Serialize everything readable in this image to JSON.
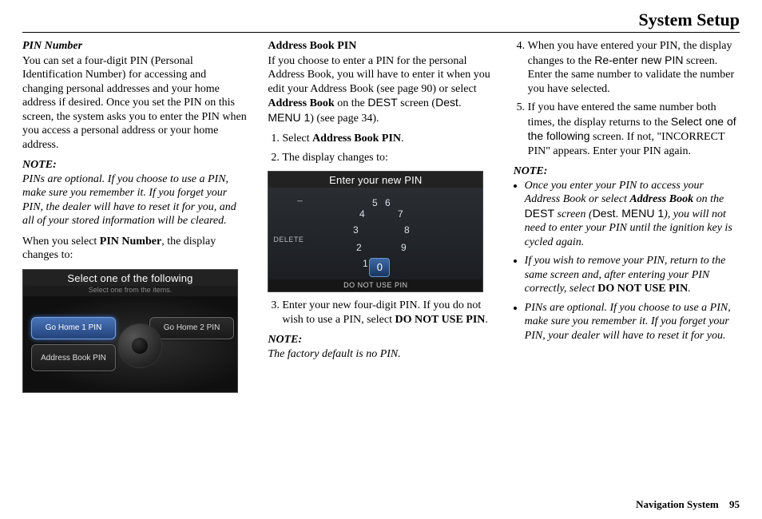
{
  "header": "System Setup",
  "footer": {
    "label": "Navigation System",
    "page": "95"
  },
  "col1": {
    "title": "PIN Number",
    "p1": "You can set a four-digit PIN (Personal Identification Number) for accessing and changing personal addresses and your home address if desired. Once you set the PIN on this screen, the system asks you to enter the PIN when you access a personal address or your home address.",
    "note_label": "NOTE:",
    "note1": "PINs are optional. If you choose to use a PIN, make sure you remember it. If you forget your PIN, the dealer will have to reset it for you, and all of your stored information will be cleared.",
    "p2_a": "When you select ",
    "p2_b": "PIN Number",
    "p2_c": ", the display changes to:",
    "shot": {
      "title": "Select one of the following",
      "subtitle": "Select one from the items.",
      "btn1": "Go Home 1 PIN",
      "btn2": "Go Home 2 PIN",
      "btn3": "Address Book PIN"
    }
  },
  "col2": {
    "title": "Address Book PIN",
    "p1_a": "If you choose to enter a PIN for the personal Address Book, you will have to enter it when you edit your Address Book (see page 90) or select ",
    "p1_b": "Address Book",
    "p1_c": " on the ",
    "p1_d": "DEST",
    "p1_e": " screen (",
    "p1_f": "Dest. MENU 1",
    "p1_g": ") (see page 34).",
    "li1_a": "Select ",
    "li1_b": "Address Book PIN",
    "li1_c": ".",
    "li2": "The display changes to:",
    "shot": {
      "title": "Enter your new PIN",
      "delete": "DELETE",
      "center": "0",
      "bottom": "DO NOT USE PIN",
      "n1": "1",
      "n2": "2",
      "n3": "3",
      "n4": "4",
      "n5": "5",
      "n6": "6",
      "n7": "7",
      "n8": "8",
      "n9": "9"
    },
    "li3_a": "Enter your new four-digit PIN. If you do not wish to use a PIN, select ",
    "li3_b": "DO NOT USE PIN",
    "li3_c": ".",
    "note_label": "NOTE:",
    "note2": "The factory default is no PIN."
  },
  "col3": {
    "li4_a": "When you have entered your PIN, the display changes to the ",
    "li4_b": "Re-enter new PIN",
    "li4_c": " screen. Enter the same number to validate the number you have selected.",
    "li5_a": "If you have entered the same number both times, the display returns to the ",
    "li5_b": "Select one of the following",
    "li5_c": " screen. If not, \"INCORRECT PIN\" appears. Enter your PIN again.",
    "note_label": "NOTE:",
    "b1_a": "Once you enter your PIN to access your Address Book or select ",
    "b1_b": "Address Book",
    "b1_c": " on the ",
    "b1_d": "DEST",
    "b1_e": " screen (",
    "b1_f": "Dest. MENU 1",
    "b1_g": "), you will not need to enter your PIN until the ignition key is cycled again.",
    "b2_a": "If you wish to remove your PIN, return to the same screen and, after entering your PIN correctly, select ",
    "b2_b": "DO NOT USE PIN",
    "b2_c": ".",
    "b3": "PINs are optional. If you choose to use a PIN, make sure you remember it. If you forget your PIN, your dealer will have to reset it for you."
  }
}
